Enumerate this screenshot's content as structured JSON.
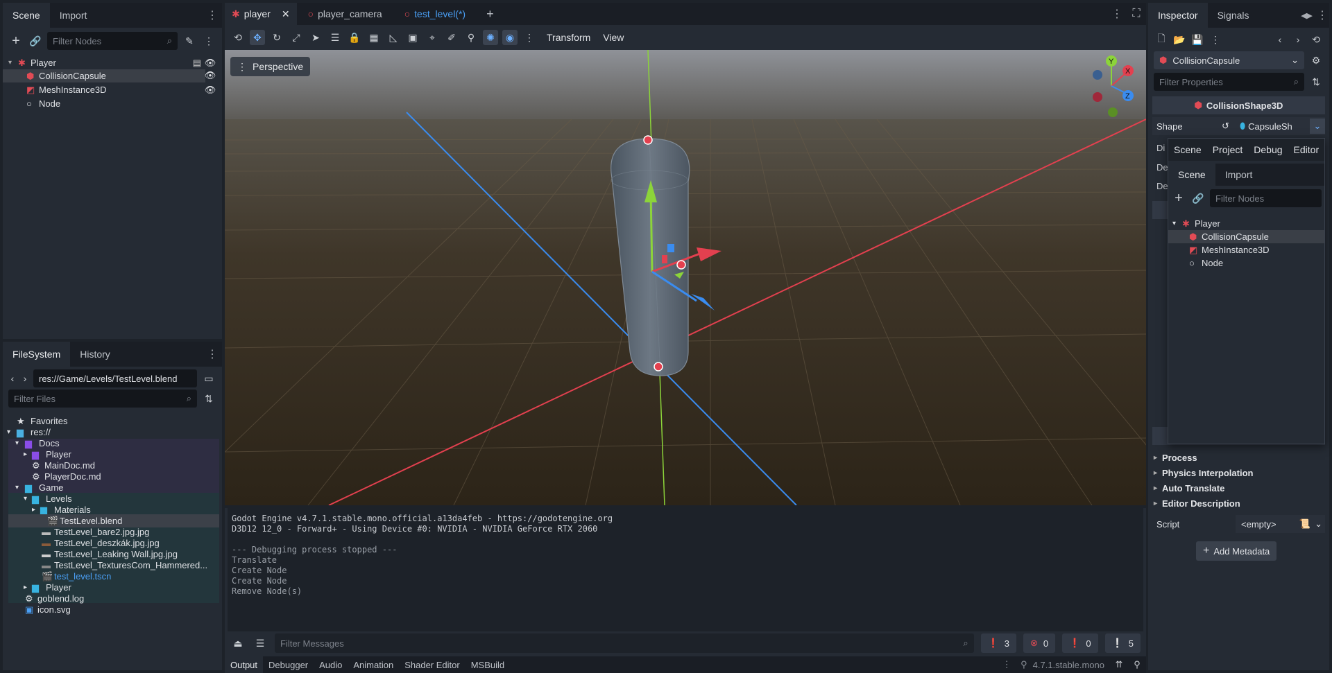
{
  "scene_dock": {
    "tabs": [
      "Scene",
      "Import"
    ],
    "filter_placeholder": "Filter Nodes",
    "nodes": [
      "Player",
      "CollisionCapsule",
      "MeshInstance3D",
      "Node"
    ]
  },
  "filesystem": {
    "tabs": [
      "FileSystem",
      "History"
    ],
    "path": "res://Game/Levels/TestLevel.blend",
    "filter_placeholder": "Filter Files",
    "items": [
      {
        "label": "Favorites"
      },
      {
        "label": "res://"
      },
      {
        "label": "Docs"
      },
      {
        "label": "Player"
      },
      {
        "label": "MainDoc.md"
      },
      {
        "label": "PlayerDoc.md"
      },
      {
        "label": "Game"
      },
      {
        "label": "Levels"
      },
      {
        "label": "Materials"
      },
      {
        "label": "TestLevel.blend"
      },
      {
        "label": "TestLevel_bare2.jpg.jpg"
      },
      {
        "label": "TestLevel_deszkák.jpg.jpg"
      },
      {
        "label": "TestLevel_Leaking Wall.jpg.jpg"
      },
      {
        "label": "TestLevel_TexturesCom_Hammered..."
      },
      {
        "label": "test_level.tscn"
      },
      {
        "label": "Player"
      },
      {
        "label": "goblend.log"
      },
      {
        "label": "icon.svg"
      }
    ]
  },
  "editor_tabs": [
    "player",
    "player_camera",
    "test_level(*)"
  ],
  "viewport_toolbar": {
    "transform": "Transform",
    "view": "View"
  },
  "viewport": {
    "perspective": "Perspective",
    "gizmo": {
      "y": "Y",
      "x": "X",
      "z": "Z"
    }
  },
  "output": {
    "lines": [
      "Godot Engine v4.7.1.stable.mono.official.a13da4feb - https://godotengine.org",
      "D3D12 12_0 - Forward+ - Using Device #0: NVIDIA - NVIDIA GeForce RTX 2060",
      "",
      "--- Debugging process stopped ---",
      "Translate",
      "Create Node",
      "Create Node",
      "Remove Node(s)"
    ],
    "filter_placeholder": "Filter Messages",
    "counts": {
      "log": "3",
      "errors": "0",
      "warnings": "0",
      "messages": "5"
    }
  },
  "bottom_tabs": [
    "Output",
    "Debugger",
    "Audio",
    "Animation",
    "Shader Editor",
    "MSBuild"
  ],
  "version": "4.7.1.stable.mono",
  "inspector": {
    "tabs": [
      "Inspector",
      "Signals"
    ],
    "node_name": "CollisionCapsule",
    "filter_placeholder": "Filter Properties",
    "class_name": "CollisionShape3D",
    "shape_label": "Shape",
    "shape_value": "CapsuleSh",
    "sections": [
      "Process",
      "Physics Interpolation",
      "Auto Translate",
      "Editor Description"
    ],
    "script_label": "Script",
    "script_value": "<empty>",
    "add_metadata": "Add Metadata",
    "hidden_prefixes": [
      "Di",
      "De",
      "De"
    ]
  },
  "popup": {
    "menu": [
      "Scene",
      "Project",
      "Debug",
      "Editor"
    ],
    "tabs": [
      "Scene",
      "Import"
    ],
    "filter_placeholder": "Filter Nodes",
    "nodes": [
      "Player",
      "CollisionCapsule",
      "MeshInstance3D",
      "Node"
    ]
  },
  "colors": {
    "accent": "#4a9ff5",
    "x_axis": "#e3404f",
    "y_axis": "#8cd43a",
    "z_axis": "#3a8cf0",
    "node_red": "#e24b55"
  }
}
